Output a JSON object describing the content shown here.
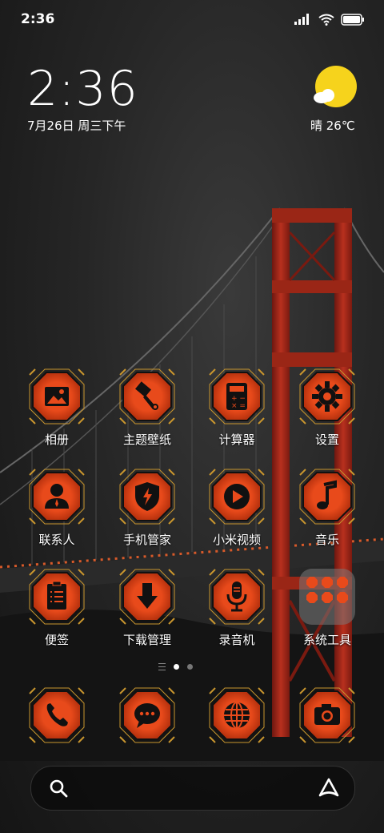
{
  "status": {
    "time": "2:36"
  },
  "clock": {
    "time": "2:36",
    "date": "7月26日 周三下午"
  },
  "weather": {
    "text": "晴 26℃",
    "icon": "sun-cloud-icon"
  },
  "apps": [
    {
      "label": "相册",
      "icon": "gallery-icon"
    },
    {
      "label": "主题壁纸",
      "icon": "paintbrush-icon"
    },
    {
      "label": "计算器",
      "icon": "calculator-icon"
    },
    {
      "label": "设置",
      "icon": "gear-icon"
    },
    {
      "label": "联系人",
      "icon": "contact-icon"
    },
    {
      "label": "手机管家",
      "icon": "shield-icon"
    },
    {
      "label": "小米视频",
      "icon": "play-icon"
    },
    {
      "label": "音乐",
      "icon": "music-note-icon"
    },
    {
      "label": "便签",
      "icon": "notes-icon"
    },
    {
      "label": "下载管理",
      "icon": "download-icon"
    },
    {
      "label": "录音机",
      "icon": "microphone-icon"
    },
    {
      "label": "系统工具",
      "icon": "folder-icon"
    }
  ],
  "dock": [
    {
      "icon": "phone-icon"
    },
    {
      "icon": "message-icon"
    },
    {
      "icon": "browser-globe-icon"
    },
    {
      "icon": "camera-icon"
    }
  ],
  "colors": {
    "accent": "#e84a1b",
    "frame": "#c9962e",
    "bridge": "#a8281a"
  }
}
